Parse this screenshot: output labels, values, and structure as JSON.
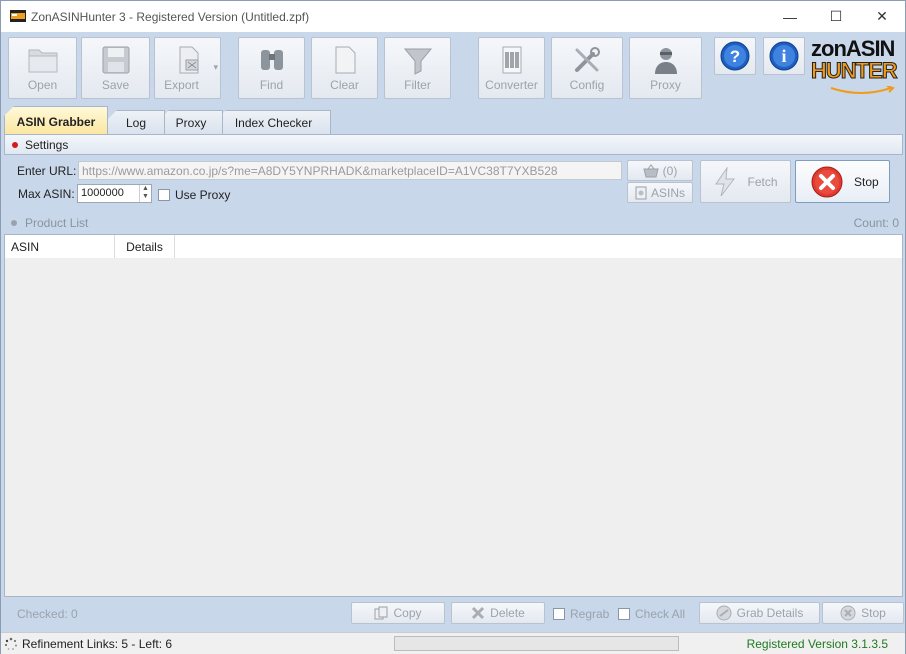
{
  "window": {
    "title": "ZonASINHunter 3 - Registered Version  (Untitled.zpf)",
    "minimize_glyph": "—",
    "maximize_glyph": "☐",
    "close_glyph": "✕"
  },
  "toolbar": {
    "buttons": [
      {
        "label": "Open",
        "icon": "folder-icon"
      },
      {
        "label": "Save",
        "icon": "floppy-icon"
      },
      {
        "label": "Export",
        "icon": "export-icon"
      },
      {
        "label": "Find",
        "icon": "binoculars-icon"
      },
      {
        "label": "Clear",
        "icon": "blank-page-icon"
      },
      {
        "label": "Filter",
        "icon": "funnel-icon"
      },
      {
        "label": "Converter",
        "icon": "barcode-icon"
      },
      {
        "label": "Config",
        "icon": "tools-icon"
      },
      {
        "label": "Proxy",
        "icon": "agent-icon"
      }
    ],
    "export_dropdown_glyph": "▾",
    "help_glyph": "?",
    "info_glyph": "i"
  },
  "logo": {
    "line1": "zonASIN",
    "line2": "HUNTER"
  },
  "tabs": [
    {
      "label": "ASIN Grabber",
      "active": true
    },
    {
      "label": "Log",
      "active": false
    },
    {
      "label": "Proxy",
      "active": false
    },
    {
      "label": "Index Checker",
      "active": false
    }
  ],
  "settings": {
    "header": "Settings",
    "url_label": "Enter URL:",
    "url_value": "https://www.amazon.co.jp/s?me=A8DY5YNPRHADK&marketplaceID=A1VC38T7YXB528",
    "max_asin_label": "Max ASIN:",
    "max_asin_value": "1000000",
    "use_proxy_label": "Use Proxy",
    "basket_count": "(0)",
    "asins_label": "ASINs",
    "fetch_label": "Fetch",
    "stop_label": "Stop"
  },
  "product_list": {
    "header": "Product List",
    "count_label": "Count: 0",
    "columns": [
      "ASIN",
      "Details"
    ]
  },
  "bottom": {
    "checked_label": "Checked: 0",
    "copy_label": "Copy",
    "delete_label": "Delete",
    "regrab_label": "Regrab",
    "check_all_label": "Check All",
    "grab_details_label": "Grab Details",
    "stop_label": "Stop"
  },
  "status": {
    "refinement": "Refinement Links: 5 - Left: 6",
    "version": "Registered Version 3.1.3.5",
    "version_color": "#1e7a1e"
  }
}
